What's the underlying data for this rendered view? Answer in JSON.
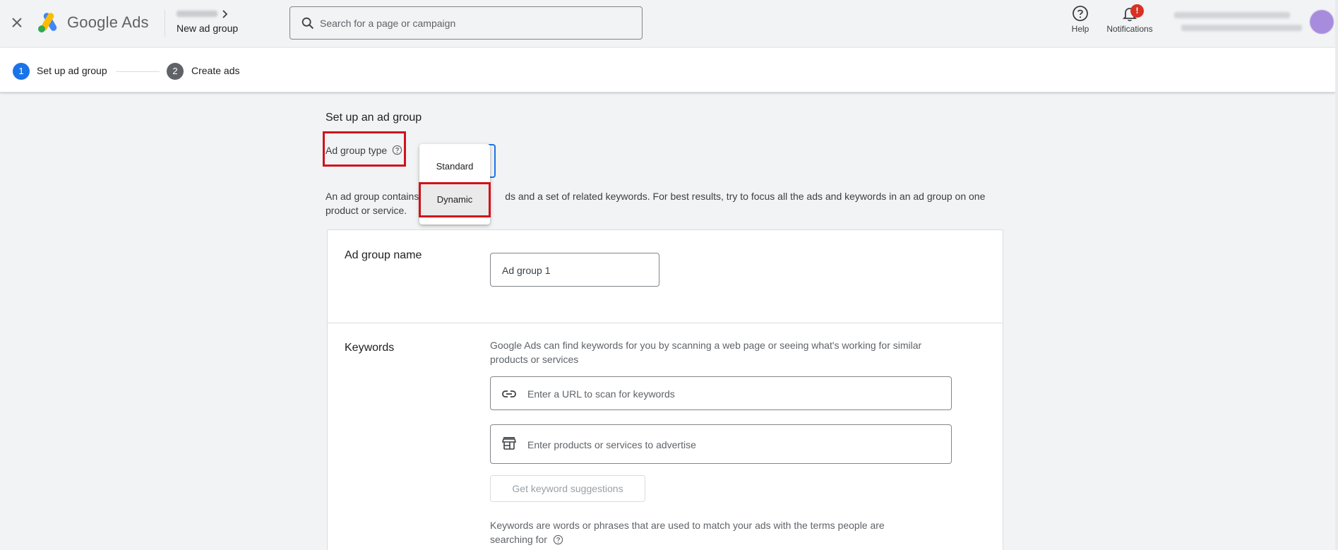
{
  "header": {
    "app_name": "Google Ads",
    "page_title": "New ad group",
    "search_placeholder": "Search for a page or campaign",
    "help_label": "Help",
    "notifications_label": "Notifications",
    "notifications_badge": "!"
  },
  "stepper": {
    "steps": [
      {
        "number": "1",
        "label": "Set up ad group",
        "state": "active"
      },
      {
        "number": "2",
        "label": "Create ads",
        "state": "upcoming"
      }
    ]
  },
  "main": {
    "section_title": "Set up an ad group",
    "ad_group_type_label": "Ad group type",
    "ad_group_type_options": [
      "Standard",
      "Dynamic"
    ],
    "ad_group_type_highlighted": "Dynamic",
    "description": "An ad group contains one or more ads and a set of related keywords. For best results, try to focus all the ads and keywords in an ad group on one product or service.",
    "description_visible_start": "An ad group contains",
    "description_visible_end": "ds and a set of related keywords. For best results, try to focus all the ads and keywords in an ad group on one product or service."
  },
  "card": {
    "ad_group_name_label": "Ad group name",
    "ad_group_name_value": "Ad group 1",
    "keywords_label": "Keywords",
    "keywords_help": "Google Ads can find keywords for you by scanning a web page or seeing what's working for similar products or services",
    "url_placeholder": "Enter a URL to scan for keywords",
    "products_placeholder": "Enter products or services to advertise",
    "suggest_button": "Get keyword suggestions",
    "keywords_note": "Keywords are words or phrases that are used to match your ads with the terms people are searching for"
  },
  "colors": {
    "accent": "#1a73e8",
    "annotation_red": "#d0121b",
    "badge_red": "#d93025"
  }
}
